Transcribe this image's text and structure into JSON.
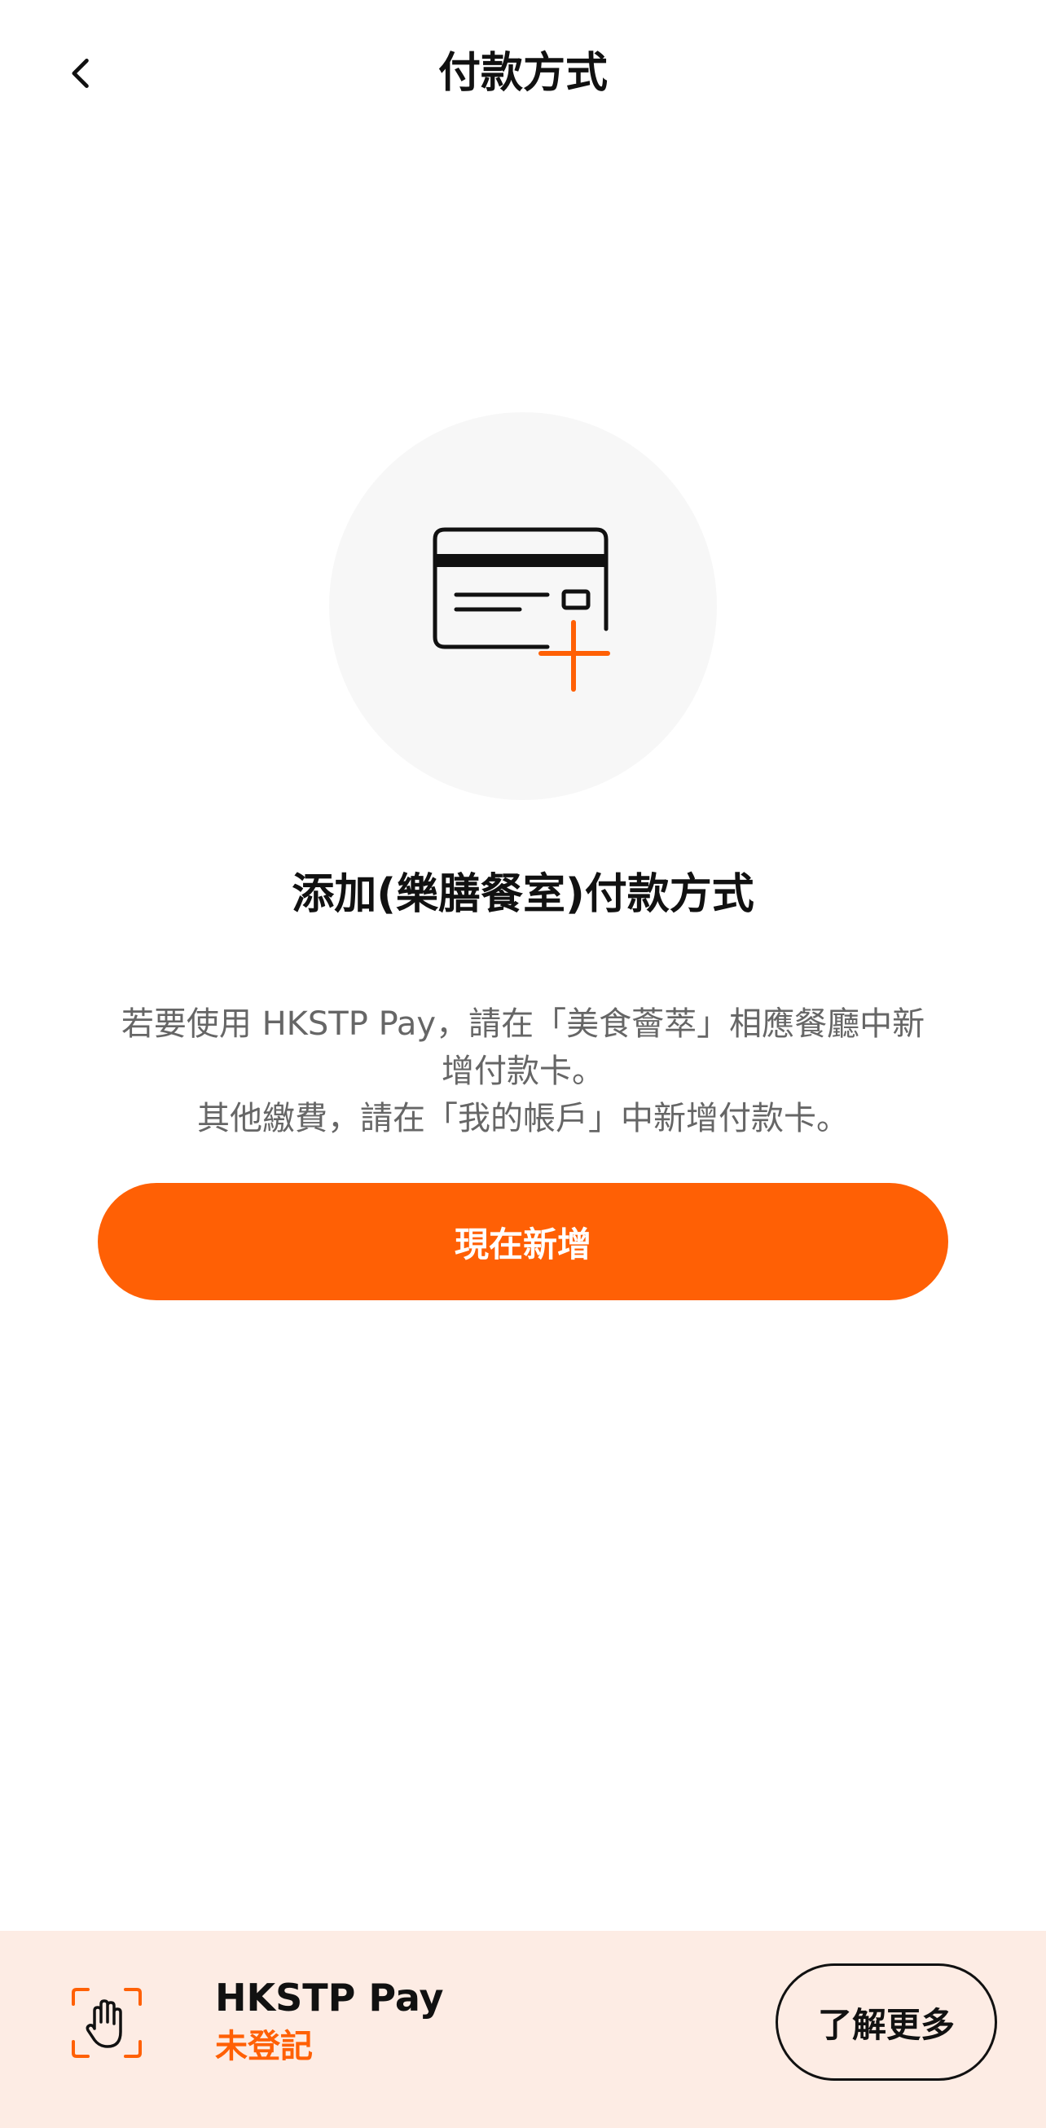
{
  "header": {
    "title": "付款方式",
    "back_icon": "chevron-left-icon"
  },
  "empty_state": {
    "icon": "credit-card-add-icon",
    "accent_color": "#ff6005",
    "title": "添加(樂膳餐室)付款方式",
    "description_lines": [
      "若要使用 HKSTP Pay，請在「美食薈萃」相應餐廳中新",
      "增付款卡。",
      "其他繳費，請在「我的帳戶」中新增付款卡。"
    ],
    "button_label": "現在新增"
  },
  "bottom_bar": {
    "icon": "palm-scan-icon",
    "name": "HKSTP Pay",
    "status": "未登記",
    "status_color": "#ff6005",
    "learn_more_label": "了解更多",
    "background_color": "#fdece4"
  }
}
